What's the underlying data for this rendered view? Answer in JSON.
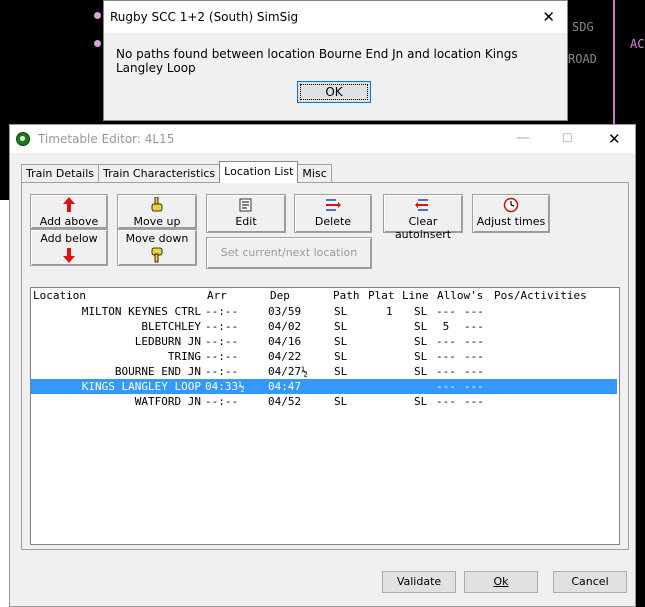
{
  "background": {
    "texts": [
      "SDG",
      "ROAD",
      "AC"
    ]
  },
  "message_box": {
    "title": "Rugby SCC 1+2 (South) SimSig",
    "message": "No paths found between location Bourne End Jn and location Kings Langley Loop",
    "ok_label": "OK"
  },
  "editor": {
    "title": "Timetable Editor: 4L15",
    "tabs": [
      {
        "label": "Train Details",
        "active": false
      },
      {
        "label": "Train Characteristics",
        "active": false
      },
      {
        "label": "Location List",
        "active": true
      },
      {
        "label": "Misc",
        "active": false
      }
    ],
    "buttons": {
      "add_above": "Add above",
      "add_below": "Add below",
      "move_up": "Move up",
      "move_down": "Move down",
      "edit": "Edit",
      "delete": "Delete",
      "clear_autoinsert": "Clear autoinsert",
      "adjust_times": "Adjust times",
      "set_current_next": "Set current/next location"
    },
    "columns": {
      "location": "Location",
      "arr": "Arr",
      "dep": "Dep",
      "path": "Path",
      "plat": "Plat",
      "line": "Line",
      "allows": "Allow's",
      "pos_activities": "Pos/Activities"
    },
    "rows": [
      {
        "location": "MILTON KEYNES CTRL",
        "arr": "--:--",
        "dep": "03/59",
        "path": "SL",
        "plat": "1",
        "line": "SL",
        "allows": "---",
        "pos": "---",
        "selected": false
      },
      {
        "location": "BLETCHLEY",
        "arr": "--:--",
        "dep": "04/02",
        "path": "SL",
        "plat": "",
        "line": "SL",
        "allows": " 5",
        "pos": "---",
        "selected": false
      },
      {
        "location": "LEDBURN JN",
        "arr": "--:--",
        "dep": "04/16",
        "path": "SL",
        "plat": "",
        "line": "SL",
        "allows": "---",
        "pos": "---",
        "selected": false
      },
      {
        "location": "TRING",
        "arr": "--:--",
        "dep": "04/22",
        "path": "SL",
        "plat": "",
        "line": "SL",
        "allows": "---",
        "pos": "---",
        "selected": false
      },
      {
        "location": "BOURNE END JN",
        "arr": "--:--",
        "dep": "04/27½",
        "path": "SL",
        "plat": "",
        "line": "SL",
        "allows": "---",
        "pos": "---",
        "selected": false
      },
      {
        "location": "KINGS LANGLEY LOOP",
        "arr": "04:33½",
        "dep": "04:47",
        "path": "",
        "plat": "",
        "line": "",
        "allows": "---",
        "pos": "---",
        "selected": true
      },
      {
        "location": "WATFORD JN",
        "arr": "--:--",
        "dep": "04/52",
        "path": "SL",
        "plat": "",
        "line": "SL",
        "allows": "---",
        "pos": "---",
        "selected": false
      }
    ],
    "footer": {
      "validate": "Validate",
      "ok": "Ok",
      "cancel": "Cancel"
    }
  }
}
